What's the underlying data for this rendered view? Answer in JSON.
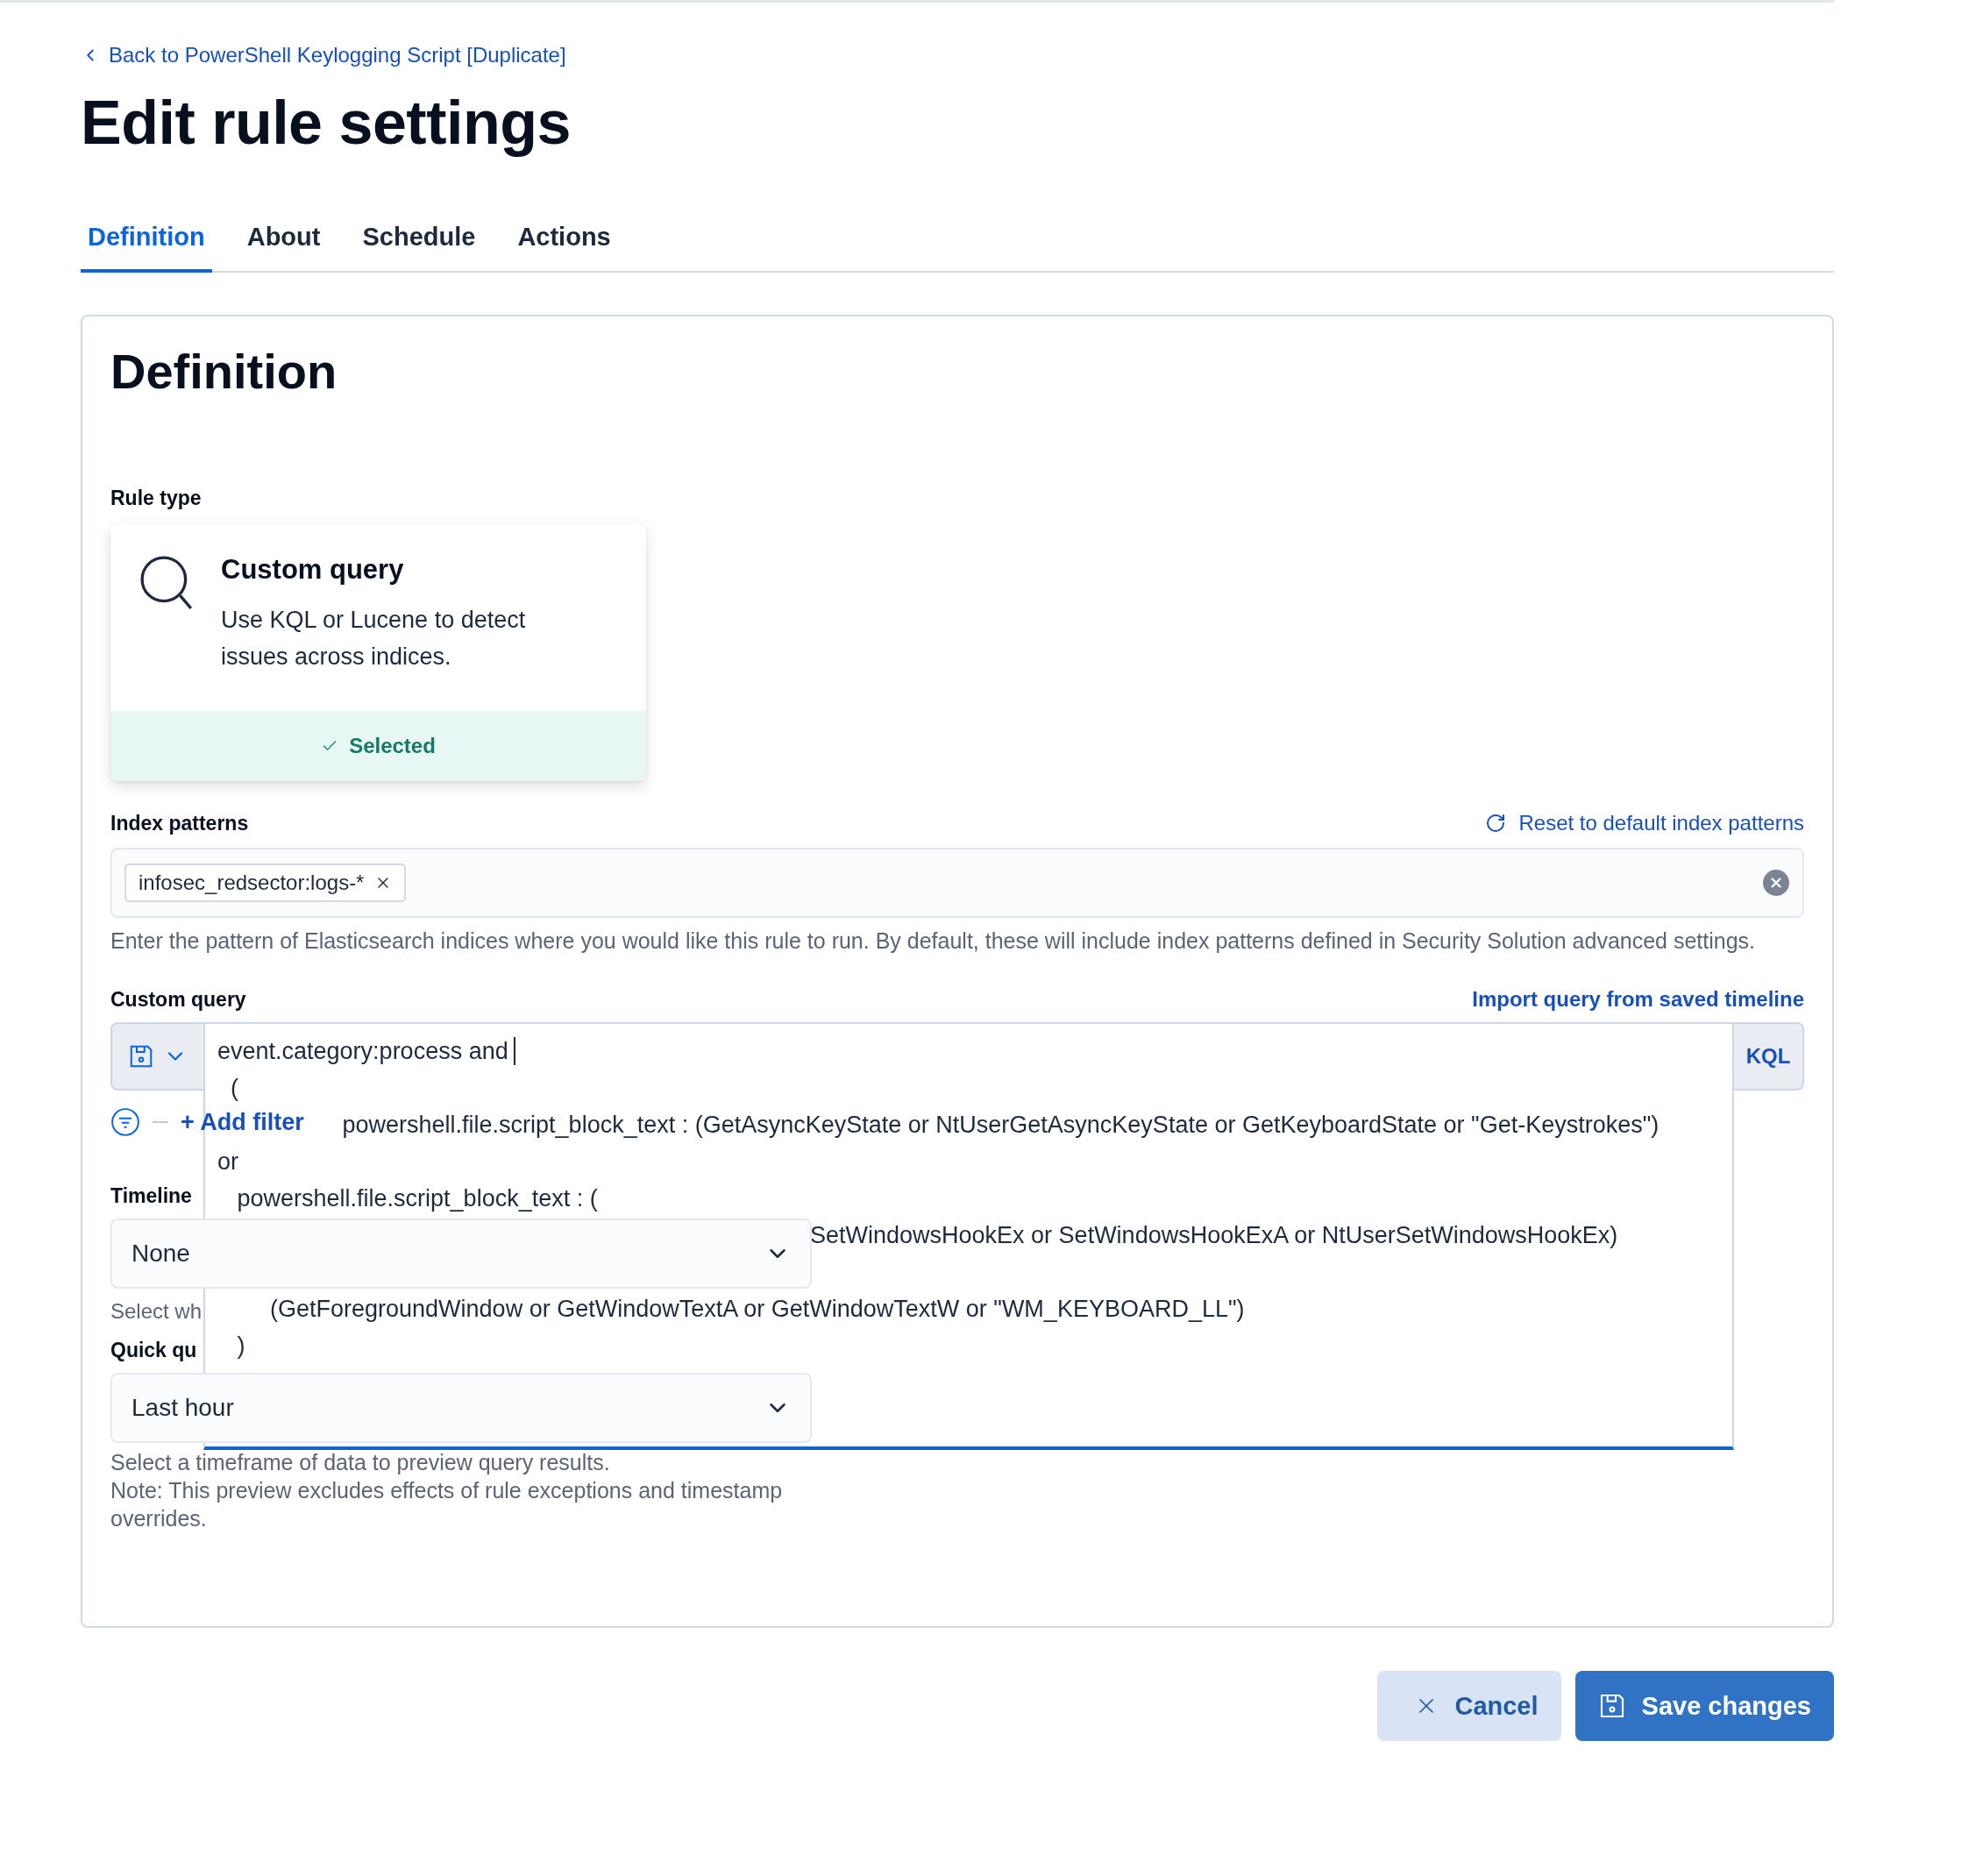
{
  "back_link": "Back to PowerShell Keylogging Script [Duplicate]",
  "title": "Edit rule settings",
  "tabs": [
    {
      "label": "Definition",
      "selected": true
    },
    {
      "label": "About",
      "selected": false
    },
    {
      "label": "Schedule",
      "selected": false
    },
    {
      "label": "Actions",
      "selected": false
    }
  ],
  "section": {
    "title": "Definition",
    "rule_type": {
      "label": "Rule type",
      "card": {
        "title": "Custom query",
        "description": "Use KQL or Lucene to detect issues across indices.",
        "selected": true,
        "status": "Selected"
      }
    },
    "index_patterns": {
      "label": "Index patterns",
      "reset_link": "Reset to default index patterns",
      "tags": [
        "infosec_redsector:logs-*"
      ],
      "help": "Enter the pattern of Elasticsearch indices where you would like this rule to run. By default, these will include index patterns defined in Security Solution advanced settings."
    },
    "custom_query": {
      "label": "Custom query",
      "import_link": "Import query from saved timeline",
      "language": "KQL",
      "add_filter": "+ Add filter",
      "lines": [
        {
          "kind": "line",
          "text": "event.category:process and"
        },
        {
          "kind": "line",
          "text": "  ("
        },
        {
          "kind": "beside_filter",
          "text": "   powershell.file.script_block_text : (GetAsyncKeyState or NtUserGetAsyncKeyState or GetKeyboardState or \"Get-Keystrokes\")"
        },
        {
          "kind": "line",
          "text": "or"
        },
        {
          "kind": "line",
          "text": "   powershell.file.script_block_text : ("
        },
        {
          "kind": "behind_select",
          "text": "SetWindowsHookEx or SetWindowsHookExA or NtUserSetWindowsHookEx)"
        },
        {
          "kind": "blank"
        },
        {
          "kind": "line",
          "text": "        (GetForegroundWindow or GetWindowTextA or GetWindowTextW or \"WM_KEYBOARD_LL\")"
        },
        {
          "kind": "line",
          "text": "   )"
        }
      ]
    },
    "timeline": {
      "label": "Timeline",
      "value": "None",
      "help": "Select wh"
    },
    "quick_query": {
      "label": "Quick qu",
      "value": "Last hour",
      "help": [
        "Select a timeframe of data to preview query results.",
        "Note: This preview excludes effects of rule exceptions and timestamp overrides."
      ]
    }
  },
  "buttons": {
    "cancel": "Cancel",
    "save": "Save changes"
  }
}
